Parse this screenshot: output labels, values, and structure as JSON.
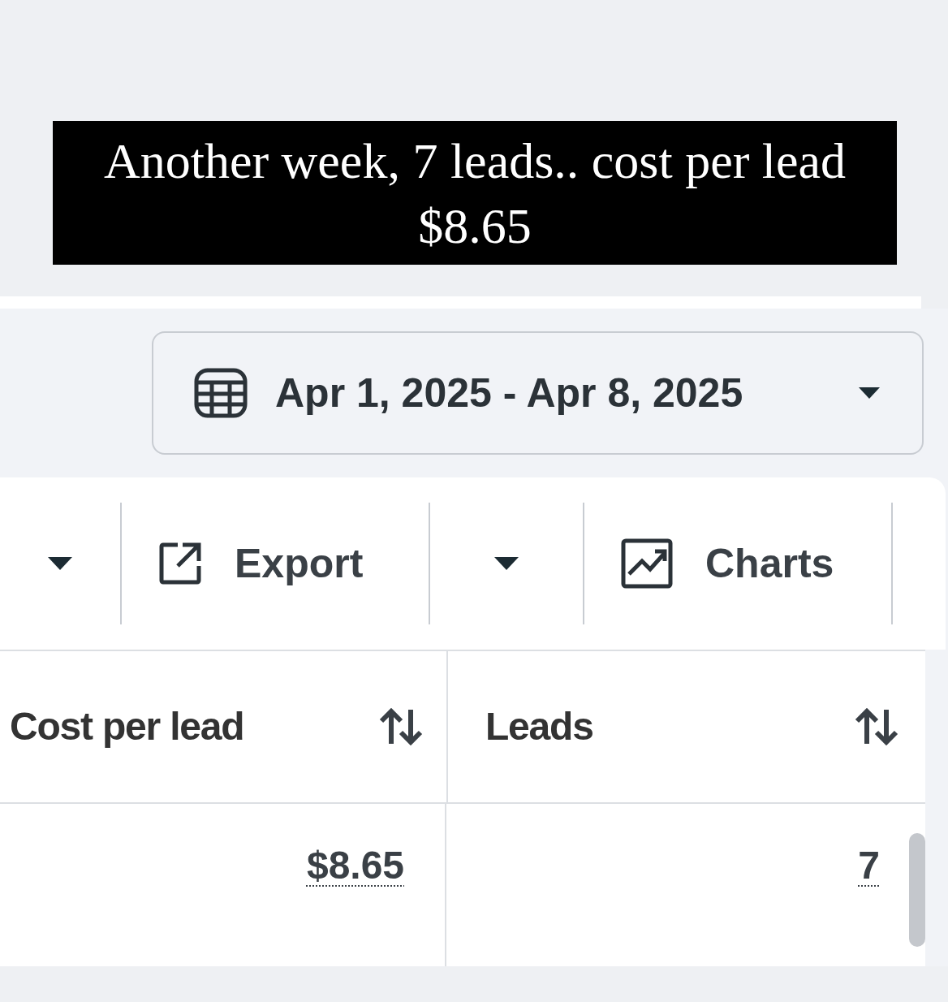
{
  "caption": "Another week, 7 leads.. cost per lead $8.65",
  "date_range": {
    "label": "Apr 1, 2025 - Apr 8, 2025"
  },
  "toolbar": [
    {
      "kind": "dropdown"
    },
    {
      "kind": "button",
      "label": "Export"
    },
    {
      "kind": "dropdown"
    },
    {
      "kind": "button",
      "label": "Charts"
    }
  ],
  "table": {
    "columns": [
      {
        "label": "Cost per lead"
      },
      {
        "label": "Leads"
      }
    ],
    "rows": [
      [
        "$8.65",
        "7"
      ]
    ]
  }
}
